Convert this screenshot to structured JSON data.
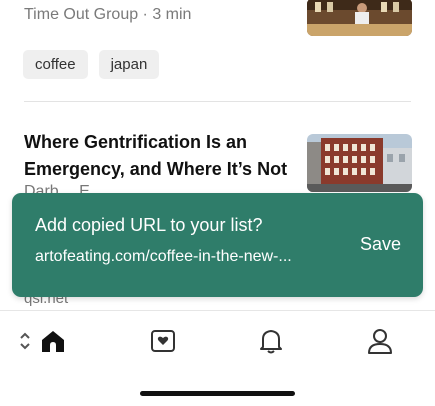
{
  "article1": {
    "meta": "Time Out Group · 3 min",
    "tags": [
      "coffee",
      "japan"
    ]
  },
  "article2": {
    "title": "Where Gentrification Is an Emergency, and Where It’s Not",
    "author_partial": "Darb…  E…",
    "domain": "qsi.net"
  },
  "toast": {
    "title": "Add copied URL to your list?",
    "url": "artofeating.com/coffee-in-the-new-...",
    "save_label": "Save",
    "background": "#2f7d6a"
  },
  "tabbar": {
    "tabs": [
      "home-icon",
      "saves-icon",
      "notifications-icon",
      "profile-icon"
    ],
    "active": "home-icon"
  }
}
